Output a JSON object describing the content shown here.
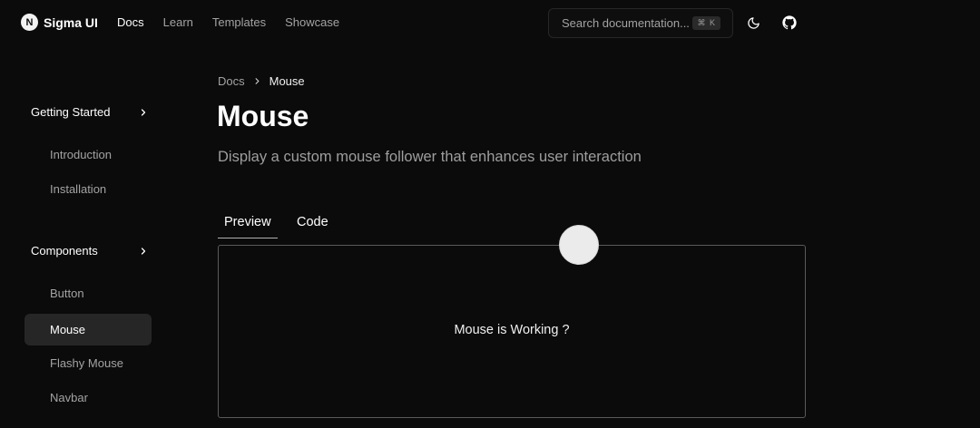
{
  "header": {
    "brand": {
      "logo_letter": "N",
      "name": "Sigma UI"
    },
    "nav": [
      {
        "label": "Docs",
        "active": true
      },
      {
        "label": "Learn",
        "active": false
      },
      {
        "label": "Templates",
        "active": false
      },
      {
        "label": "Showcase",
        "active": false
      }
    ],
    "search": {
      "placeholder": "Search documentation...",
      "shortcut": "⌘ K"
    },
    "icons": {
      "theme": "moon-icon",
      "repo": "github-icon"
    }
  },
  "sidebar": {
    "sections": [
      {
        "label": "Getting Started",
        "items": [
          "Introduction",
          "Installation"
        ]
      },
      {
        "label": "Components",
        "items": [
          "Button",
          "Mouse",
          "Flashy Mouse",
          "Navbar"
        ]
      }
    ],
    "active_item": "Mouse"
  },
  "main": {
    "breadcrumb": {
      "root": "Docs",
      "current": "Mouse"
    },
    "title": "Mouse",
    "description": "Display a custom mouse follower that enhances user interaction",
    "tabs": [
      {
        "label": "Preview",
        "active": true
      },
      {
        "label": "Code",
        "active": false
      }
    ],
    "preview_text": "Mouse is Working ?"
  },
  "colors": {
    "background": "#0b0b0b",
    "text_primary": "#ffffff",
    "text_muted": "#a3a3a3",
    "active_bg": "#262626",
    "follower": "#ebebeb"
  }
}
